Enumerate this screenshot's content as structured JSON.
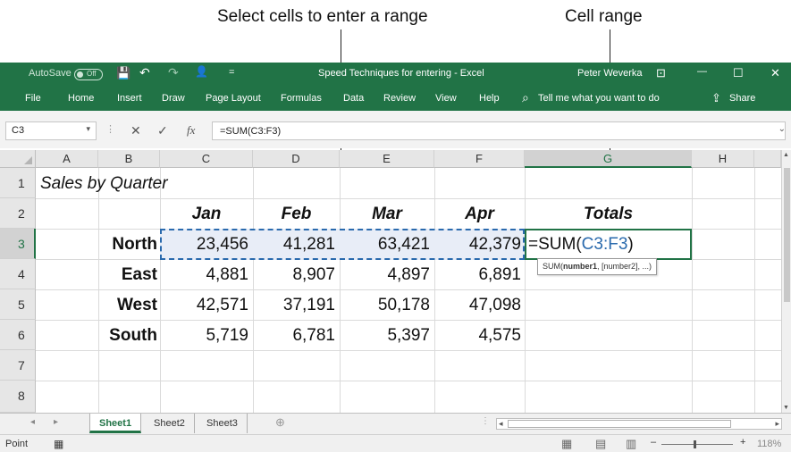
{
  "callouts": {
    "select": "Select cells to enter a range",
    "range": "Cell range"
  },
  "titlebar": {
    "autosave": "AutoSave",
    "autosave_state": "Off",
    "save_icon": "💾",
    "undo_icon": "↶",
    "redo_icon": "↷",
    "person_icon": "👤",
    "customize_icon": "=",
    "doc_title": "Speed Techniques for entering - Excel",
    "user": "Peter Weverka",
    "ribbon_display_icon": "⊡",
    "minimize": "—",
    "maximize": "☐",
    "close": "✕"
  },
  "ribbon": {
    "tabs": [
      "File",
      "Home",
      "Insert",
      "Draw",
      "Page Layout",
      "Formulas",
      "Data",
      "Review",
      "View",
      "Help"
    ],
    "tell_icon": "⌕",
    "tell_me": "Tell me what you want to do",
    "share_icon": "⇪",
    "share": "Share"
  },
  "formula_bar": {
    "name_box": "C3",
    "name_dd": "▾",
    "sep": "⋮",
    "cancel": "✕",
    "enter": "✓",
    "fx": "fx",
    "formula": "=SUM(C3:F3)",
    "expand": "⌄"
  },
  "grid": {
    "columns": [
      "A",
      "B",
      "C",
      "D",
      "E",
      "F",
      "G",
      "H"
    ],
    "selected_column": "G",
    "rows": [
      "1",
      "2",
      "3",
      "4",
      "5",
      "6",
      "7",
      "8"
    ],
    "selected_row": "3",
    "title": "Sales by Quarter",
    "month_headers": [
      "Jan",
      "Feb",
      "Mar",
      "Apr"
    ],
    "totals_header": "Totals",
    "data_rows": [
      {
        "region": "North",
        "values": [
          "23,456",
          "41,281",
          "63,421",
          "42,379"
        ]
      },
      {
        "region": "East",
        "values": [
          "4,881",
          "8,907",
          "4,897",
          "6,891"
        ]
      },
      {
        "region": "West",
        "values": [
          "42,571",
          "37,191",
          "50,178",
          "47,098"
        ]
      },
      {
        "region": "South",
        "values": [
          "5,719",
          "6,781",
          "5,397",
          "4,575"
        ]
      }
    ],
    "formula_prefix": "=SUM(",
    "formula_ref": "C3:F3",
    "formula_suffix": ")",
    "tooltip_fn": "SUM(",
    "tooltip_arg1": "number1",
    "tooltip_rest": ", [number2], ...)"
  },
  "sheets": {
    "tabs": [
      "Sheet1",
      "Sheet2",
      "Sheet3"
    ],
    "active": "Sheet1",
    "prev": "◂",
    "next": "▸",
    "add_icon": "⊕",
    "dots": "⋮",
    "scroll_left": "◂",
    "scroll_right": "▸"
  },
  "statusbar": {
    "mode": "Point",
    "macro_icon": "▦",
    "view_normal": "▦",
    "view_page": "▤",
    "view_break": "▥",
    "zoom_minus": "–",
    "zoom_plus": "+",
    "zoom": "118%"
  }
}
